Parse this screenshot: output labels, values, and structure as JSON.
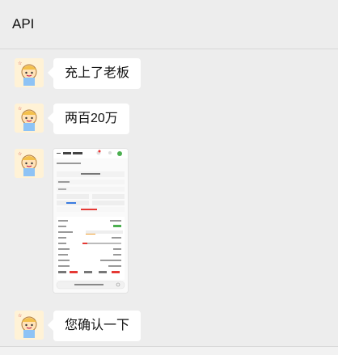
{
  "header": {
    "title": "API"
  },
  "messages": [
    {
      "text": "充上了老板"
    },
    {
      "text": "两百20万"
    },
    {
      "text": ""
    },
    {
      "text": "您确认一下"
    }
  ]
}
